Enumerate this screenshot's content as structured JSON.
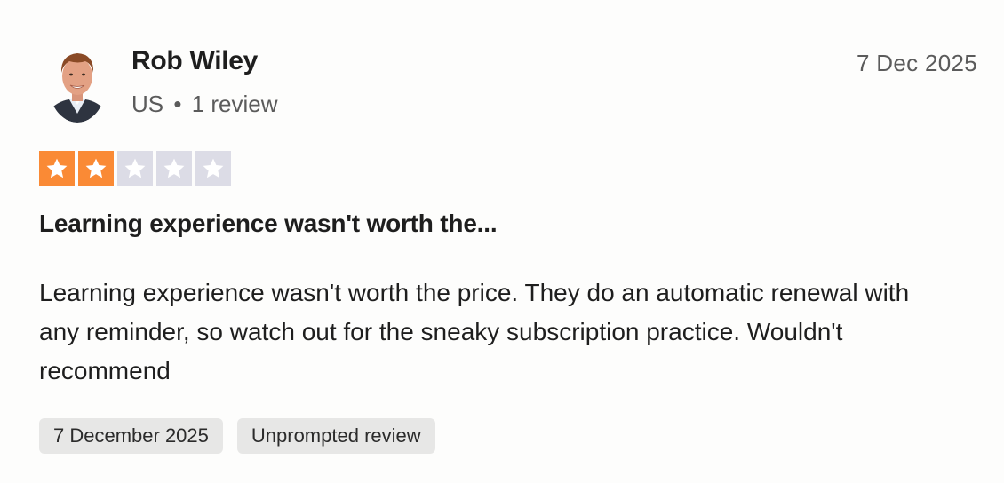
{
  "reviewer": {
    "name": "Rob Wiley",
    "country": "US",
    "separator": "•",
    "review_count": "1 review",
    "avatar_icon": "avatar-photo"
  },
  "review": {
    "date_short": "7 Dec 2025",
    "rating": 2,
    "rating_max": 5,
    "star_color_filled": "#fa8a35",
    "star_color_empty": "#dcdce6",
    "title": "Learning experience wasn't worth the...",
    "body": "Learning experience wasn't worth the price. They do an automatic renewal with any reminder, so watch out for the sneaky subscription practice. Wouldn't recommend",
    "tags": [
      "7 December 2025",
      "Unprompted review"
    ]
  }
}
